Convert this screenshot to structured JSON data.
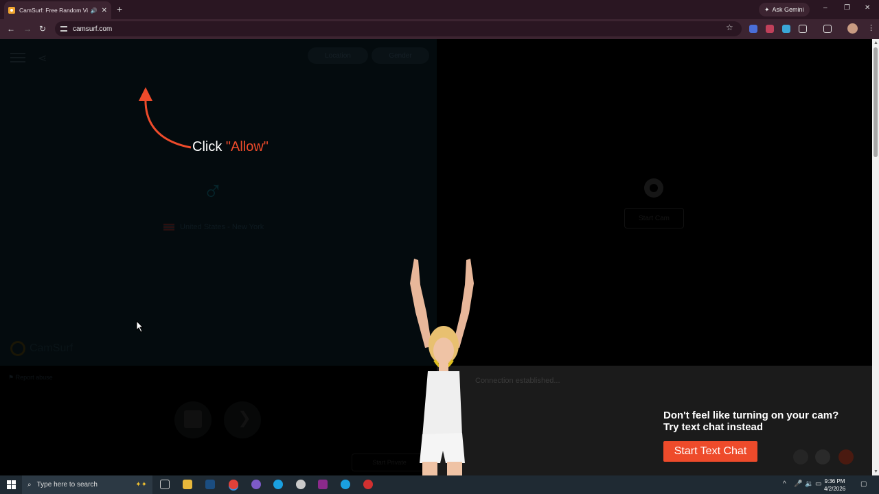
{
  "browser": {
    "tab": {
      "title": "CamSurf: Free Random Vide",
      "sound_icon": "speaker-icon",
      "close": "✕"
    },
    "new_tab": "+",
    "gemini_label": "Ask Gemini",
    "url": "camsurf.com",
    "window_controls": [
      "–",
      "❐",
      "✕"
    ]
  },
  "page": {
    "filters": {
      "location": "Location",
      "gender": "Gender"
    },
    "location_text": "United States - New York",
    "logo_text": "CamSurf",
    "report_label": "Report abuse",
    "instruction": {
      "click": "Click",
      "allow": "\"Allow\""
    },
    "start_cam": "Start Cam",
    "connection_status": "Connection established...",
    "sound_button": "Start Private",
    "promo": {
      "line1": "Don't feel like turning on your cam?",
      "line2": "Try text chat instead",
      "button": "Start Text Chat"
    },
    "accent": "#ee4b2b"
  },
  "taskbar": {
    "search_placeholder": "Type here to search",
    "time": "9:36 PM",
    "date": "4/2/2026"
  }
}
